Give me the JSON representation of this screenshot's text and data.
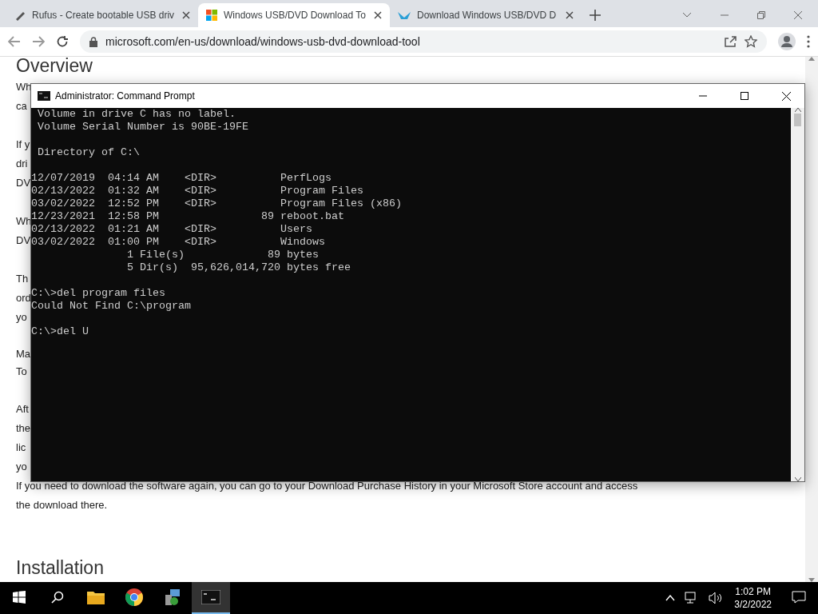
{
  "browser": {
    "tabs": [
      {
        "title": "Rufus - Create bootable USB driv",
        "selected": false,
        "kind": "usb"
      },
      {
        "title": "Windows USB/DVD Download To",
        "selected": true,
        "kind": "windows"
      },
      {
        "title": "Download Windows USB/DVD D",
        "selected": false,
        "kind": "bird"
      }
    ],
    "address": "microsoft.com/en-us/download/windows-usb-dvd-download-tool"
  },
  "page": {
    "blocks": [
      {
        "kind": "heading",
        "text": "Overview"
      },
      {
        "kind": "line",
        "text": "Wh"
      },
      {
        "kind": "line",
        "text": "ca"
      },
      {
        "kind": "gap"
      },
      {
        "kind": "line",
        "text": "If y"
      },
      {
        "kind": "line",
        "text": "dri"
      },
      {
        "kind": "line",
        "text": "DV"
      },
      {
        "kind": "gap"
      },
      {
        "kind": "line",
        "text": "Wh"
      },
      {
        "kind": "line",
        "text": "DV"
      },
      {
        "kind": "gap"
      },
      {
        "kind": "line",
        "text": "Th"
      },
      {
        "kind": "line",
        "text": "ord"
      },
      {
        "kind": "line",
        "text": "yo"
      },
      {
        "kind": "gap"
      },
      {
        "kind": "tight",
        "text": "Ma"
      },
      {
        "kind": "tight",
        "text": "To"
      },
      {
        "kind": "gap"
      },
      {
        "kind": "line",
        "text": "Aft"
      },
      {
        "kind": "line",
        "text": "the"
      },
      {
        "kind": "line",
        "text": "lic"
      },
      {
        "kind": "line",
        "text": "yo"
      },
      {
        "kind": "line",
        "text": "If you need to download the software again, you can go to your Download Purchase History in your Microsoft Store account and access"
      },
      {
        "kind": "line",
        "text": "the download there."
      },
      {
        "kind": "gap"
      },
      {
        "kind": "gap"
      },
      {
        "kind": "heading2",
        "text": "Installation"
      }
    ]
  },
  "console": {
    "title": "Administrator: Command Prompt",
    "lines": [
      {
        "kind": "text",
        "text": " Volume in drive C has no label."
      },
      {
        "kind": "text",
        "text": " Volume Serial Number is 90BE-19FE"
      },
      {
        "kind": "blank"
      },
      {
        "kind": "text",
        "text": " Directory of C:\\"
      },
      {
        "kind": "blank"
      },
      {
        "kind": "text",
        "text": "12/07/2019  04:14 AM    <DIR>          PerfLogs"
      },
      {
        "kind": "text",
        "text": "02/13/2022  01:32 AM    <DIR>          Program Files"
      },
      {
        "kind": "text",
        "text": "03/02/2022  12:52 PM    <DIR>          Program Files (x86)"
      },
      {
        "kind": "text",
        "text": "12/23/2021  12:58 PM                89 reboot.bat"
      },
      {
        "kind": "text",
        "text": "02/13/2022  01:21 AM    <DIR>          Users"
      },
      {
        "kind": "text",
        "text": "03/02/2022  01:00 PM    <DIR>          Windows"
      },
      {
        "kind": "text",
        "text": "               1 File(s)             89 bytes"
      },
      {
        "kind": "text",
        "text": "               5 Dir(s)  95,626,014,720 bytes free"
      },
      {
        "kind": "blank"
      },
      {
        "kind": "text",
        "text": "C:\\>del program files"
      },
      {
        "kind": "text",
        "text": "Could Not Find C:\\program"
      },
      {
        "kind": "blank"
      },
      {
        "kind": "text",
        "text": "C:\\>del U"
      }
    ]
  },
  "taskbar": {
    "apps": [
      {
        "kind": "explorer",
        "active": false
      },
      {
        "kind": "chrome",
        "active": false
      },
      {
        "kind": "installer",
        "active": false
      },
      {
        "kind": "console",
        "active": true
      }
    ],
    "time": "1:02 PM",
    "date": "3/2/2022"
  }
}
